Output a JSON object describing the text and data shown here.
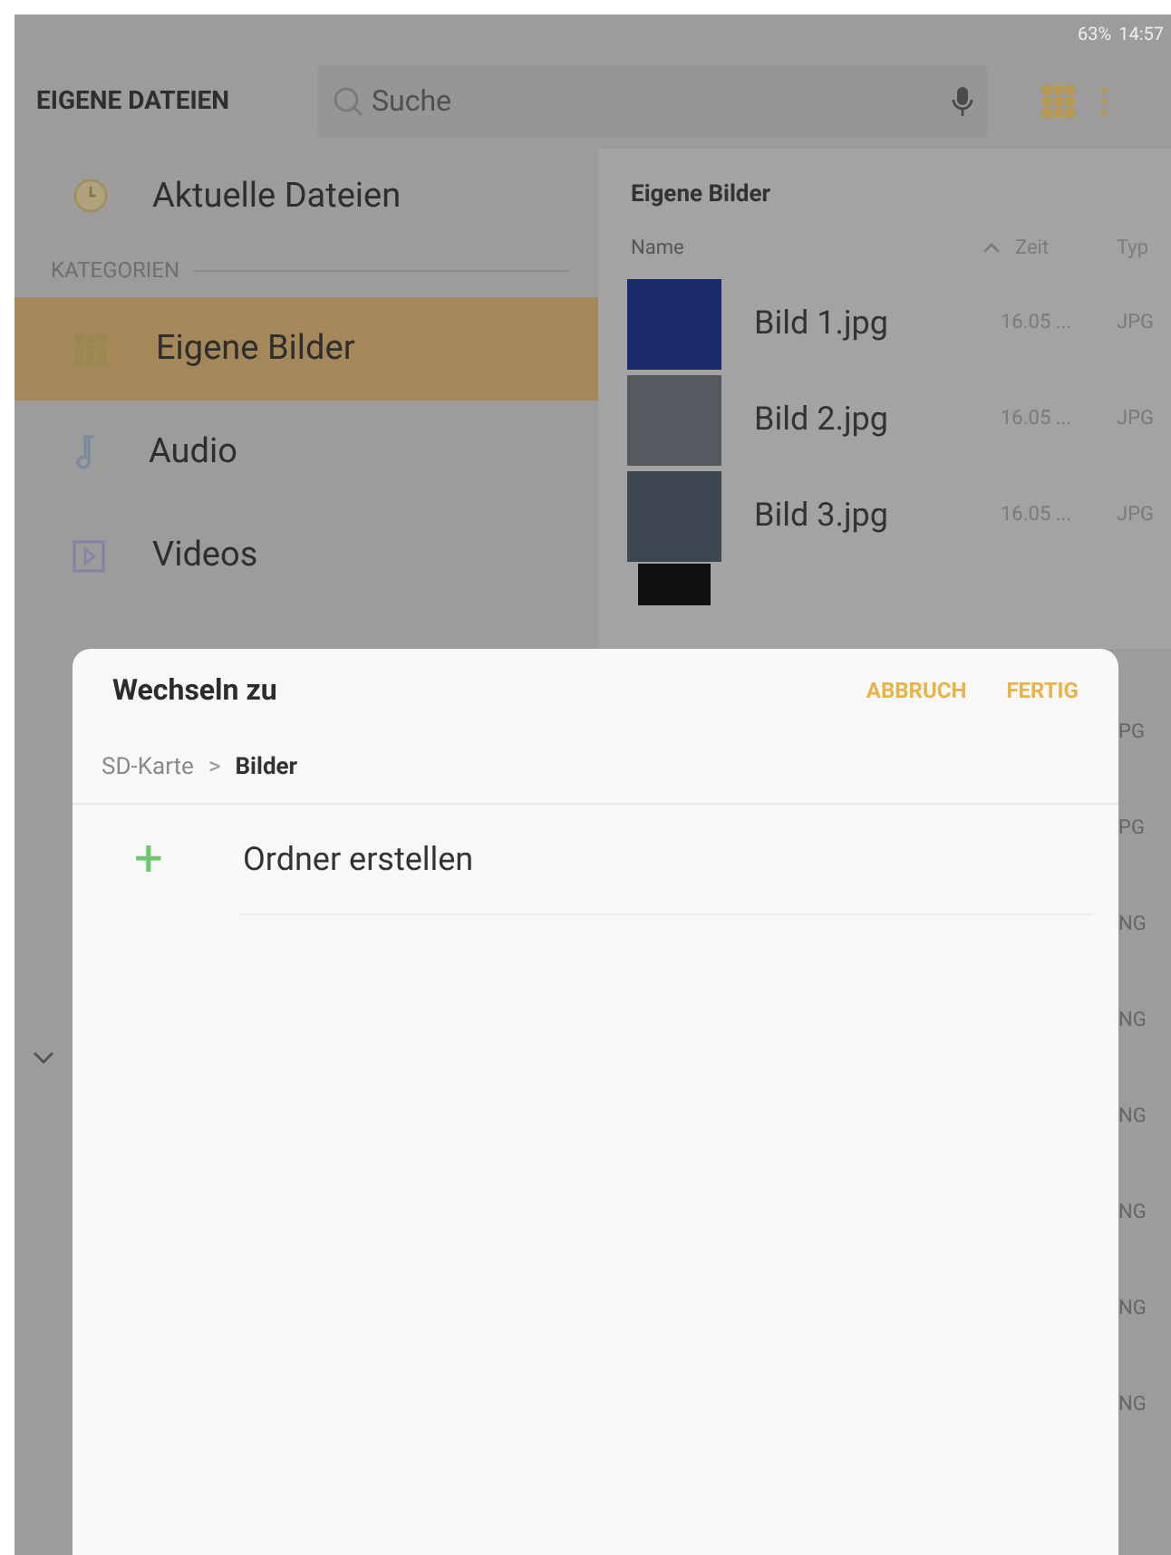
{
  "status_bar": {
    "battery": "63%",
    "time": "14:57"
  },
  "header": {
    "title": "EIGENE DATEIEN",
    "search": {
      "placeholder": "Suche"
    }
  },
  "sidebar": {
    "recent": {
      "label": "Aktuelle Dateien",
      "selected": false
    },
    "section_title": "KATEGORIEN",
    "items": [
      {
        "label": "Eigene Bilder",
        "kind": "images",
        "selected": true
      },
      {
        "label": "Audio",
        "kind": "audio",
        "selected": false
      },
      {
        "label": "Videos",
        "kind": "videos",
        "selected": false
      }
    ]
  },
  "file_pane": {
    "title": "Eigene Bilder",
    "columns": [
      "Name",
      "Zeit",
      "Typ"
    ],
    "rows": [
      {
        "name": "Bild 1.jpg",
        "date": "16.05 ...",
        "type": "JPG"
      },
      {
        "name": "Bild 2.jpg",
        "date": "16.05 ...",
        "type": "JPG"
      },
      {
        "name": "Bild 3.jpg",
        "date": "16.05 ...",
        "type": "JPG"
      }
    ],
    "hidden_row_types": [
      "PG",
      "PG",
      "NG",
      "NG",
      "NG",
      "NG",
      "NG",
      "NG"
    ]
  },
  "dialog": {
    "title": "Wechseln zu",
    "buttons": [
      "ABBRUCH",
      "FERTIG"
    ],
    "breadcrumb": [
      {
        "label": "SD-Karte",
        "selected": false
      },
      {
        "label": "Bilder",
        "selected": true
      }
    ],
    "separator": ">",
    "create_folder": {
      "icon": "+",
      "label": "Ordner erstellen"
    }
  }
}
